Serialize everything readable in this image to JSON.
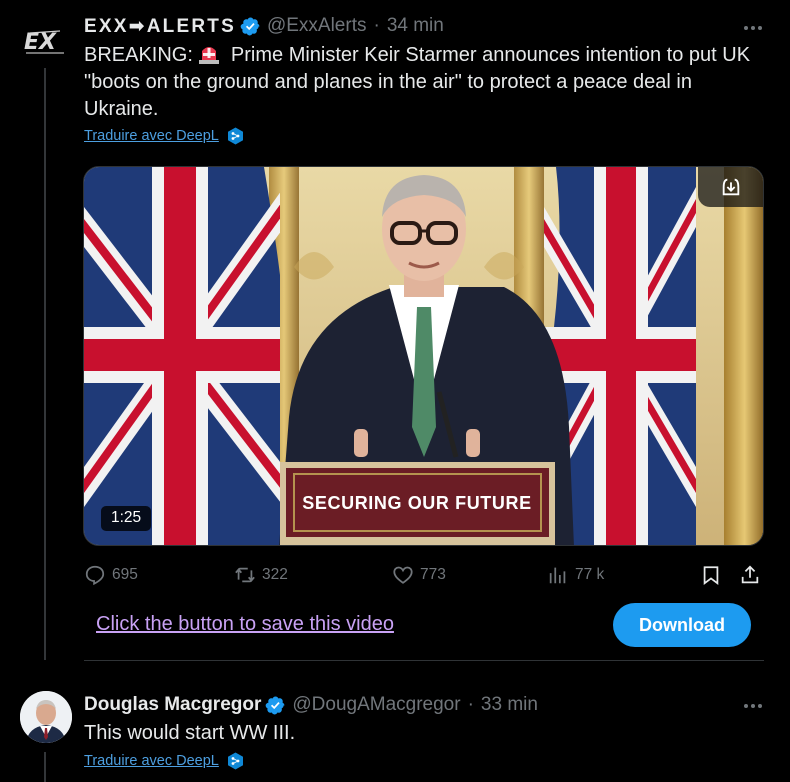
{
  "colors": {
    "background": "#000000",
    "text": "#e7e9ea",
    "muted": "#71767b",
    "link": "#4d9fe0",
    "visited_link": "#c9a2f5",
    "accent": "#1d9bf0",
    "divider": "#2f3336"
  },
  "tweet1": {
    "avatar_icon": "exx-alerts-logo-icon",
    "display_name": "EXX➡ALERTS",
    "handle": "@ExxAlerts",
    "separator": "·",
    "time": "34 min",
    "text_prefix": "BREAKING:",
    "text_emoji": "police-light-emoji",
    "text_body": "Prime Minister Keir Starmer announces intention to put UK \"boots on the ground and planes in the air\" to protect a peace deal in Ukraine.",
    "translate_label": "Traduire avec DeepL",
    "media": {
      "podium_text": "SECURING OUR FUTURE",
      "duration": "1:25",
      "download_icon": "download-icon"
    },
    "actions": {
      "replies": "695",
      "reposts": "322",
      "likes": "773",
      "views": "77 k"
    }
  },
  "save_bar": {
    "link_text": "Click the button to save this video",
    "button_label": "Download"
  },
  "tweet2": {
    "avatar_icon": "douglas-macgregor-avatar",
    "display_name": "Douglas Macgregor",
    "handle": "@DougAMacgregor",
    "separator": "·",
    "time": "33 min",
    "text": "This would start WW III.",
    "translate_label": "Traduire avec DeepL"
  }
}
